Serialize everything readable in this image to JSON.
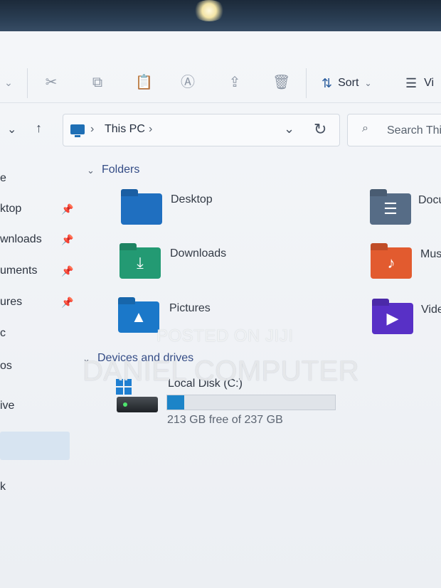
{
  "toolbar": {
    "sort_label": "Sort",
    "view_label": "Vi",
    "icons": [
      "cut-icon",
      "copy-icon",
      "paste-icon",
      "rename-icon",
      "share-icon",
      "delete-icon"
    ]
  },
  "nav": {
    "breadcrumb": [
      "This PC"
    ],
    "search_placeholder": "Search This"
  },
  "sidebar": {
    "items": [
      {
        "label": "e"
      },
      {
        "label": "ktop"
      },
      {
        "label": "wnloads"
      },
      {
        "label": "uments"
      },
      {
        "label": "ures"
      },
      {
        "label": "c"
      },
      {
        "label": "os"
      },
      {
        "label": "ive"
      },
      {
        "label": "k"
      }
    ]
  },
  "folders": {
    "heading": "Folders",
    "items": [
      {
        "label": "Desktop",
        "color": "#1f6fc0"
      },
      {
        "label": "Downloads",
        "color": "#239a73"
      },
      {
        "label": "Pictures",
        "color": "#1b78c9"
      },
      {
        "label": "Docu",
        "color": "#566c86"
      },
      {
        "label": "Mus",
        "color": "#e25b2f"
      },
      {
        "label": "Vide",
        "color": "#5830c6"
      }
    ]
  },
  "devices": {
    "heading": "Devices and drives",
    "disk_name": "Local Disk (C:)",
    "disk_free": "213 GB free of 237 GB",
    "usage_fraction": 0.101
  },
  "watermark": {
    "line1": "POSTED ON JIJI",
    "line2": "DANIEL COMPUTER"
  }
}
